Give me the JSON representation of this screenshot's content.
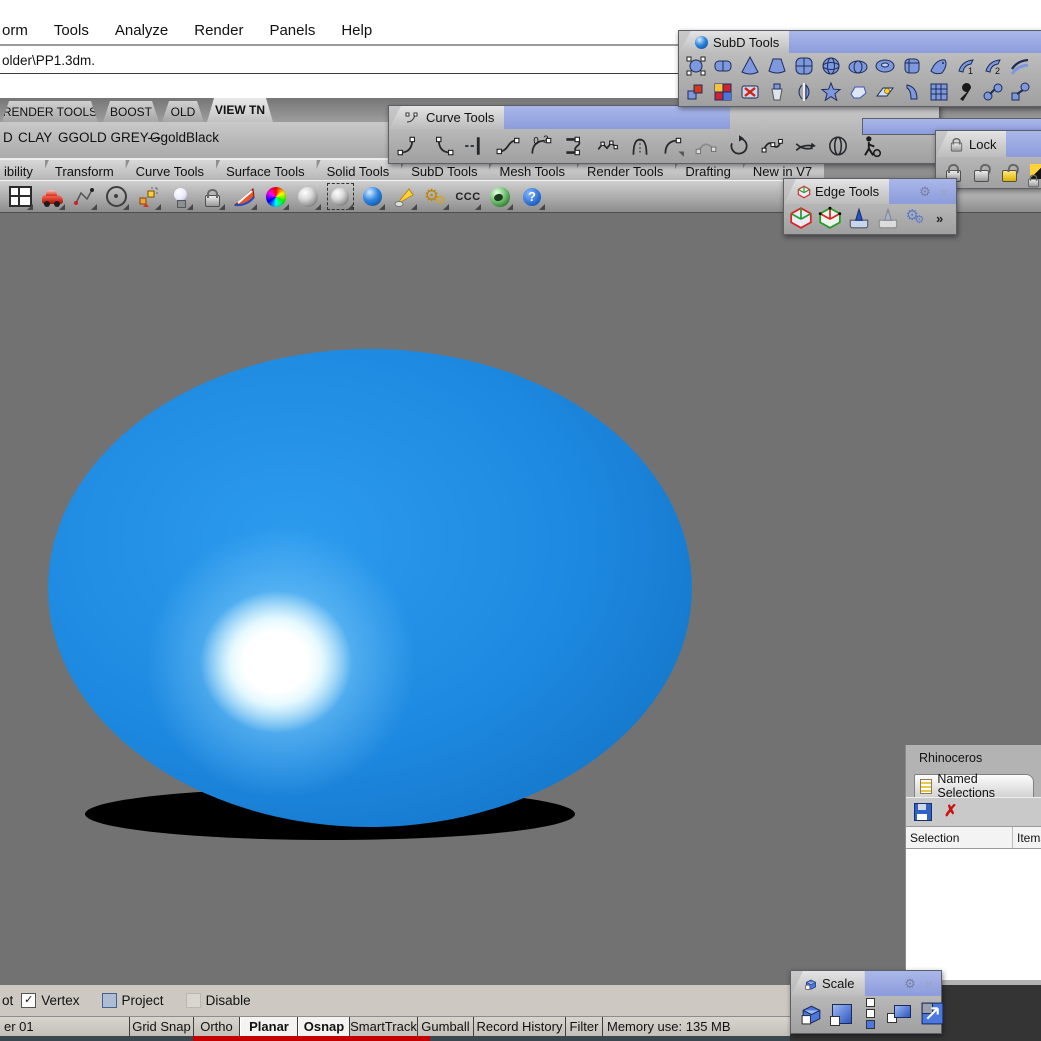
{
  "menu": {
    "items": [
      "orm",
      "Tools",
      "Analyze",
      "Render",
      "Panels",
      "Help"
    ]
  },
  "command": {
    "text": "older\\PP1.3dm."
  },
  "view_tabs": {
    "items": [
      "RENDER TOOLS",
      "BOOST",
      "OLD",
      "VIEW TN"
    ],
    "active": "VIEW TN"
  },
  "quick_row": {
    "items": [
      "D",
      "CLAY",
      "GGOLD GREY---",
      "GgoldBlack"
    ]
  },
  "group_tabs": {
    "items": [
      "ibility",
      "Transform",
      "Curve Tools",
      "Surface Tools",
      "Solid Tools",
      "SubD Tools",
      "Mesh Tools",
      "Render Tools",
      "Drafting",
      "New in V7"
    ]
  },
  "main_toolbar": {
    "ccc_label": "CCC",
    "help_glyph": "?"
  },
  "chrome": {
    "gear": "⚙",
    "close": "×"
  },
  "subd_palette": {
    "title": "SubD Tools",
    "rail1": "1",
    "rail2": "2"
  },
  "curve_palette": {
    "title": "Curve Tools",
    "blend0": "0",
    "blend2": "2"
  },
  "lock_palette": {
    "title": "Lock"
  },
  "edge_palette": {
    "title": "Edge Tools",
    "overflow": "»"
  },
  "scale_palette": {
    "title": "Scale"
  },
  "rhino_panel": {
    "window_title": "Rhinoceros",
    "tab": "Named Selections",
    "columns": {
      "selection": "Selection",
      "items": "Items"
    },
    "delete_glyph": "✗"
  },
  "osnap_row": {
    "prefix": "ot",
    "vertex": "Vertex",
    "project": "Project",
    "disable": "Disable",
    "check": "✓"
  },
  "status_bar": {
    "layer": "er 01",
    "cells": [
      "Grid Snap",
      "Ortho",
      "Planar",
      "Osnap",
      "SmartTrack",
      "Gumball",
      "Record History",
      "Filter"
    ],
    "memory": "Memory use: 135 MB"
  },
  "viewport": {
    "object": "blue-subd-dome"
  }
}
